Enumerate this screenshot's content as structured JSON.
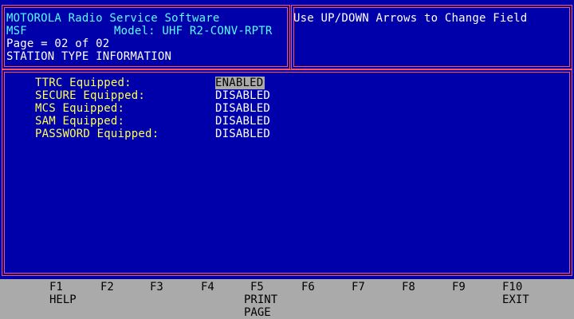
{
  "header": {
    "app_title": "MOTOROLA Radio Service Software",
    "app_short": "MSF",
    "model_label": "Model: UHF R2-CONV-RPTR",
    "page": "Page = 02 of 02",
    "section": "STATION TYPE INFORMATION",
    "hint": "Use UP/DOWN Arrows to Change Field"
  },
  "fields": [
    {
      "label": "TTRC Equipped:",
      "value": "ENABLED",
      "selected": true
    },
    {
      "label": "SECURE Equipped:",
      "value": "DISABLED",
      "selected": false
    },
    {
      "label": "MCS Equipped:",
      "value": "DISABLED",
      "selected": false
    },
    {
      "label": "SAM Equipped:",
      "value": "DISABLED",
      "selected": false
    },
    {
      "label": "PASSWORD Equipped:",
      "value": "DISABLED",
      "selected": false
    }
  ],
  "function_keys": [
    {
      "key": "F1",
      "line1": "HELP",
      "line2": ""
    },
    {
      "key": "F2",
      "line1": "",
      "line2": ""
    },
    {
      "key": "F3",
      "line1": "",
      "line2": ""
    },
    {
      "key": "F4",
      "line1": "",
      "line2": ""
    },
    {
      "key": "F5",
      "line1": "PRINT",
      "line2": "PAGE"
    },
    {
      "key": "F6",
      "line1": "",
      "line2": ""
    },
    {
      "key": "F7",
      "line1": "",
      "line2": ""
    },
    {
      "key": "F8",
      "line1": "",
      "line2": ""
    },
    {
      "key": "F9",
      "line1": "",
      "line2": ""
    },
    {
      "key": "F10",
      "line1": "EXIT",
      "line2": ""
    }
  ],
  "colors": {
    "background": "#0000aa",
    "border": "#ff5555",
    "header_text": "#55ffff",
    "field_label": "#ffff55",
    "field_value": "#ffffff",
    "selection_bg": "#aaaaaa",
    "fkey_bar": "#aaaaaa"
  }
}
